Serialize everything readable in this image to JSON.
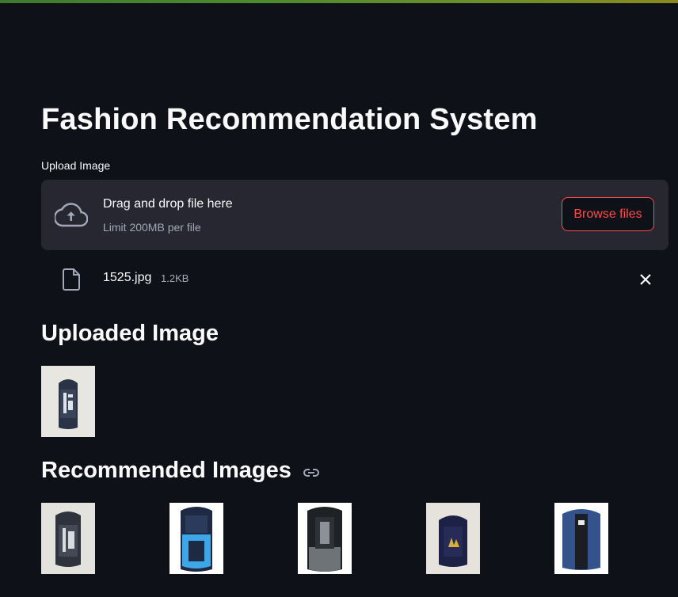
{
  "title": "Fashion Recommendation System",
  "uploader": {
    "label": "Upload Image",
    "drop_text": "Drag and drop file here",
    "limit_text": "Limit 200MB per file",
    "browse_label": "Browse files"
  },
  "file": {
    "name": "1525.jpg",
    "size": "1.2KB"
  },
  "uploaded_heading": "Uploaded Image",
  "recommended_heading": "Recommended Images",
  "colors": {
    "accent": "#ff4b4b",
    "background": "#0e1117",
    "dropzone": "#262730"
  },
  "icons": [
    "cloud-upload-icon",
    "file-icon",
    "close-icon",
    "link-icon"
  ]
}
